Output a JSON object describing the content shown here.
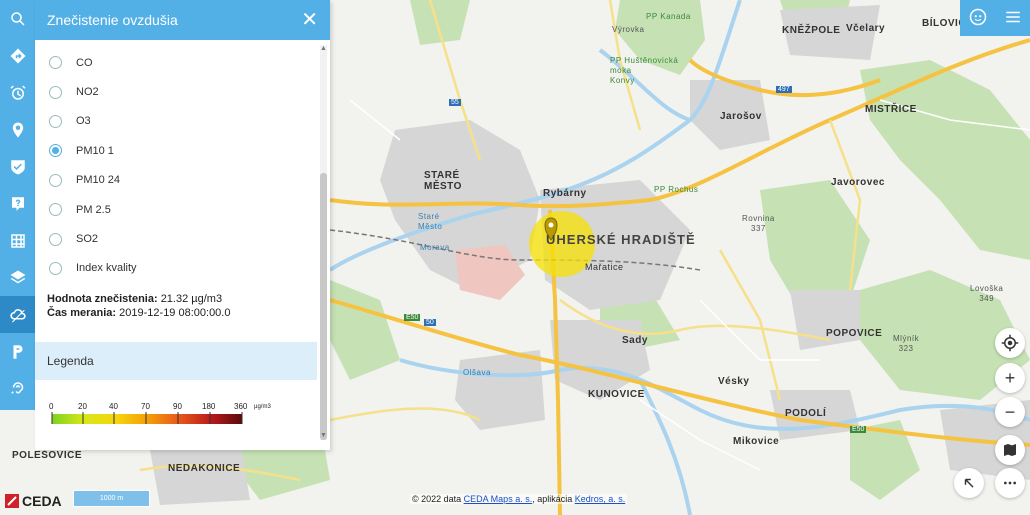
{
  "panel": {
    "title": "Znečistenie ovzdušia",
    "close_glyph": "✕",
    "options": [
      {
        "label": "CO",
        "selected": false
      },
      {
        "label": "NO2",
        "selected": false
      },
      {
        "label": "O3",
        "selected": false
      },
      {
        "label": "PM10 1",
        "selected": true
      },
      {
        "label": "PM10 24",
        "selected": false
      },
      {
        "label": "PM 2.5",
        "selected": false
      },
      {
        "label": "SO2",
        "selected": false
      },
      {
        "label": "Index kvality",
        "selected": false
      }
    ],
    "value_label": "Hodnota znečistenia:",
    "value": "21.32 µg/m3",
    "time_label": "Čas merania:",
    "time": "2019-12-19 08:00:00.0",
    "legend_title": "Legenda",
    "legend_ticks": [
      "0",
      "20",
      "40",
      "70",
      "90",
      "180",
      "360"
    ],
    "legend_unit": "µg/m3"
  },
  "sidebar_icons": [
    "search-icon",
    "directions-icon",
    "alarm-icon",
    "location-pin-icon",
    "shield-check-icon",
    "help-icon",
    "grid-icon",
    "layers-icon",
    "cloud-pollution-icon",
    "parking-icon",
    "hearing-icon"
  ],
  "map_labels": {
    "uherske_hradiste": "UHERSKÉ HRADIŠTĚ",
    "stare_mesto": "STARÉ\nMĚSTO",
    "rybarny": "Rybárny",
    "maratice": "Mařatice",
    "sady": "Sady",
    "kunovice": "KUNOVICE",
    "vesky": "Vésky",
    "podoli": "PODOLÍ",
    "mikovice": "Mikovice",
    "popovice": "POPOVICE",
    "javorovec": "Javorovec",
    "jarosov": "Jarošov",
    "mistrice": "MISTŘICE",
    "knezpole": "KNĚŽPOLE",
    "bilovice": "BÍLOVICE",
    "vcelary": "Včelary",
    "polesovice": "POLEŠOVICE",
    "nedakonice": "NEDAKONICE",
    "vyrovka": "Výrovka",
    "pp_kanada": "PP Kanada",
    "pp_hustenovicka": "PP Huštěnovická\nmoka\nKonvy",
    "pp_rochus": "PP Rochus",
    "rovnina": "Rovnina\n337",
    "lovoska": "Lovoška\n349",
    "mlynik": "Mlýník\n323",
    "olsava": "Olšava",
    "morava": "Morava",
    "stare_mesto_river": "Staré\nMěsto"
  },
  "road_badges": [
    "55",
    "E50",
    "50",
    "497",
    "E50"
  ],
  "footer": {
    "prefix": "© 2022 data ",
    "link1": "CEDA Maps a. s.",
    "middle": ", aplikácia ",
    "link2": "Kedros, a. s."
  },
  "logo_text": "CEDA",
  "scale_text": "1000 m",
  "right_controls": [
    "compass-icon",
    "zoom-in-button",
    "zoom-out-button",
    "map-type-icon",
    "collapse-icon",
    "more-options-icon"
  ],
  "top_right": [
    "user-face-icon",
    "menu-icon"
  ],
  "colors": {
    "accent": "#52b0e6",
    "active": "#2e89c7",
    "pollution": "#f5e000"
  }
}
